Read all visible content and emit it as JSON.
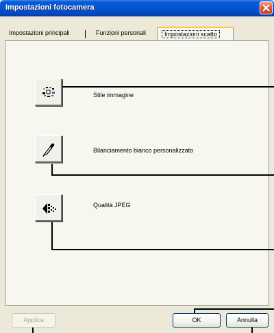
{
  "window": {
    "title": "Impostazioni fotocamera"
  },
  "tabs": [
    {
      "label": "Impostazioni principali",
      "active": false
    },
    {
      "label": "Funzioni personali",
      "active": false
    },
    {
      "label": "Impostazioni scatto",
      "active": true
    }
  ],
  "settings": [
    {
      "label": "Stile immagine",
      "icon": "picture-style-icon"
    },
    {
      "label": "Bilanciamento bianco personalizzato",
      "icon": "eyedropper-icon"
    },
    {
      "label": "Qualità JPEG",
      "icon": "jpeg-quality-icon"
    }
  ],
  "buttons": {
    "apply": "Applica",
    "ok": "OK",
    "cancel": "Annulla"
  },
  "colors": {
    "title_bar": "#0554d0",
    "window_bg": "#ece9d8",
    "panel_bg": "#f7f6ef",
    "close_button": "#e2593a",
    "active_tab_accent": "#ffc73c"
  }
}
